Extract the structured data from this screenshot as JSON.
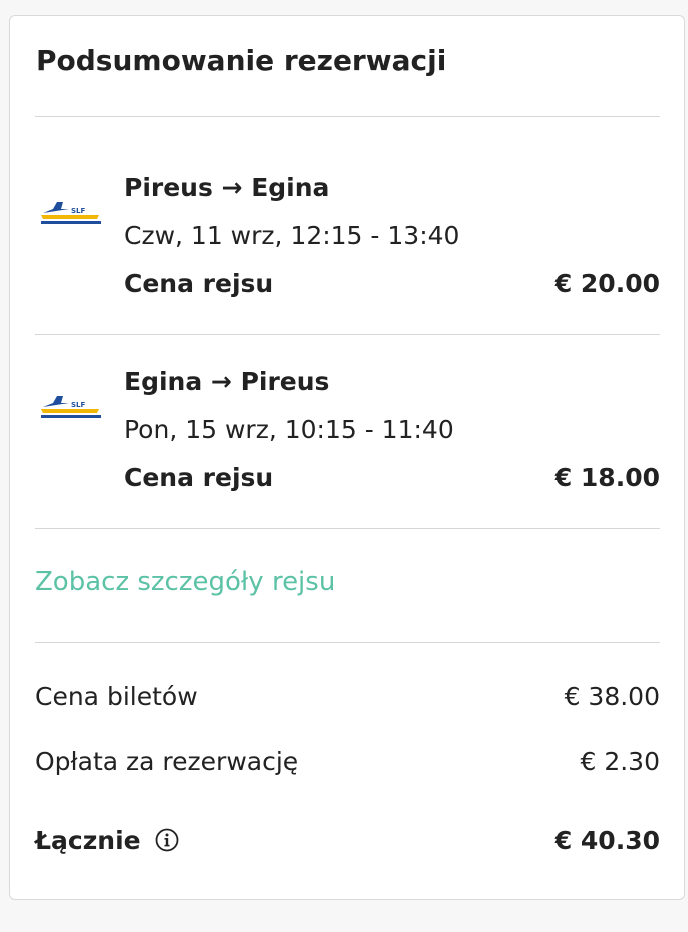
{
  "summary": {
    "title": "Podsumowanie rezerwacji",
    "trips": [
      {
        "operator_logo": "SLF",
        "route": "Pireus → Egina",
        "datetime": "Czw, 11 wrz, 12:15 - 13:40",
        "price_label": "Cena rejsu",
        "price": "€ 20.00"
      },
      {
        "operator_logo": "SLF",
        "route": "Egina → Pireus",
        "datetime": "Pon, 15 wrz, 10:15 - 11:40",
        "price_label": "Cena rejsu",
        "price": "€ 18.00"
      }
    ],
    "details_link": "Zobacz szczegóły rejsu",
    "tickets_label": "Cena biletów",
    "tickets_value": "€ 38.00",
    "fee_label": "Opłata za rezerwację",
    "fee_value": "€ 2.30",
    "total_label": "Łącznie",
    "total_value": "€ 40.30",
    "info_icon": "info-icon"
  },
  "colors": {
    "link": "#5cc2a6",
    "logo_blue": "#1f4f9c",
    "logo_yellow": "#f2b705",
    "divider": "#d6d6d6",
    "text": "#222222"
  }
}
